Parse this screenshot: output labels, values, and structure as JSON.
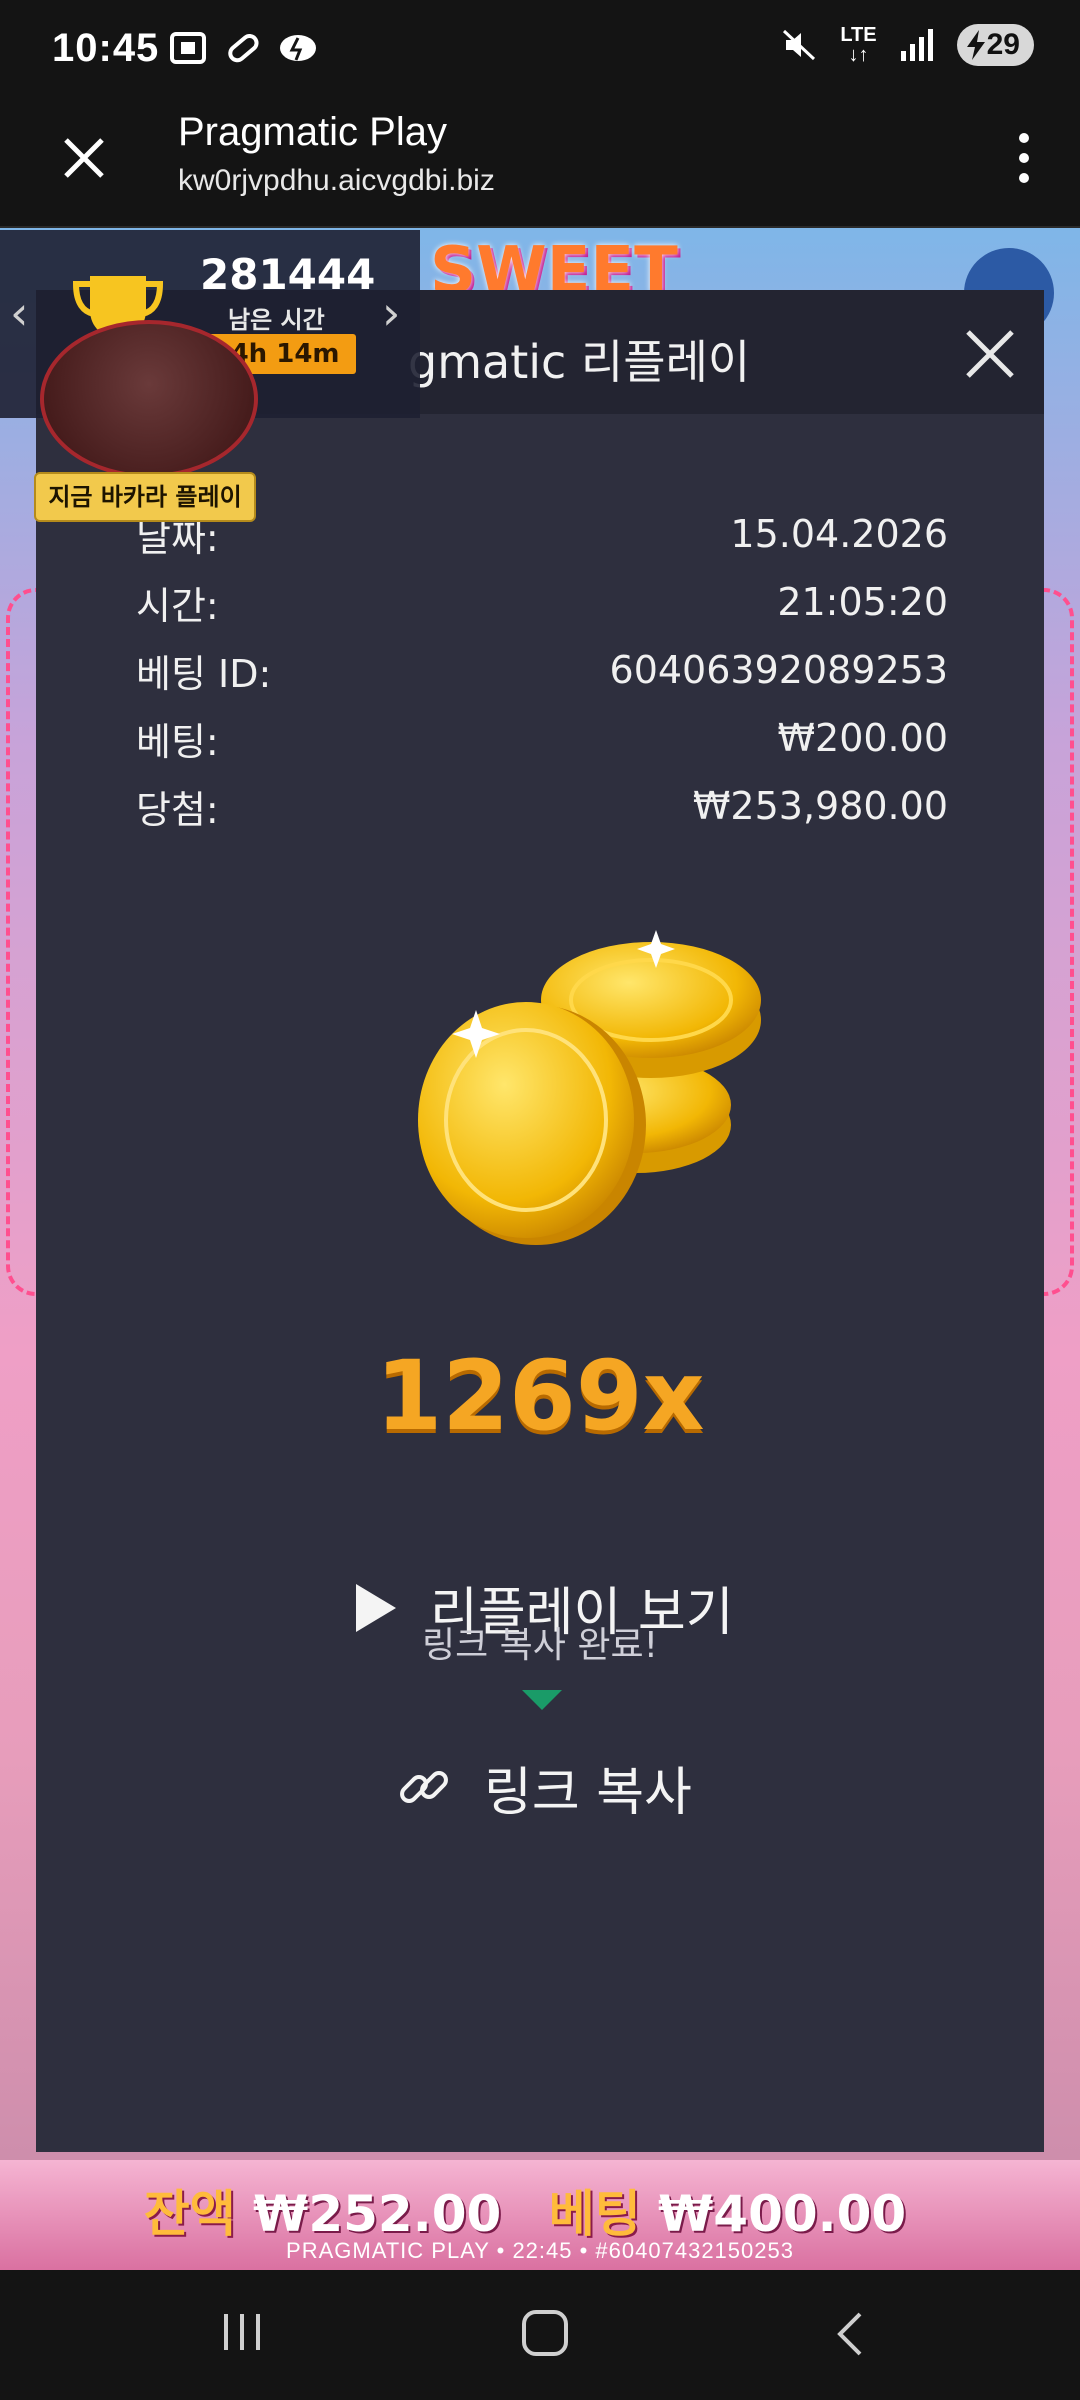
{
  "status_bar": {
    "time": "10:45",
    "lte": "LTE",
    "battery": "29"
  },
  "browser": {
    "title": "Pragmatic Play",
    "url": "kw0rjvpdhu.aicvgdbi.biz"
  },
  "tournament": {
    "score": "281444",
    "time_left_label": "남은 시간",
    "timer": "04h 14m",
    "baccarat_label": "지금 바카라 플레이"
  },
  "modal": {
    "title": "gmatic 리플레이",
    "rows": [
      {
        "label": "날짜:",
        "value": "15.04.2026"
      },
      {
        "label": "시간:",
        "value": "21:05:20"
      },
      {
        "label": "베팅 ID:",
        "value": "60406392089253"
      },
      {
        "label": "베팅:",
        "value": "₩200.00"
      },
      {
        "label": "당첨:",
        "value": "₩253,980.00"
      }
    ],
    "multiplier": "1269x",
    "replay_label": "리플레이 보기",
    "toast": "링크 복사 완료!",
    "copy_link_label": "링크 복사"
  },
  "balance_bar": {
    "balance_label": "잔액",
    "balance_value": "₩252.00",
    "bet_label": "베팅",
    "bet_value": "₩400.00",
    "footer": "PRAGMATIC PLAY • 22:45 • #60407432150253"
  },
  "colors": {
    "modal_bg": "#2e2f3e",
    "accent_gold": "#f5a623",
    "toast_arrow": "#1a9b68"
  }
}
